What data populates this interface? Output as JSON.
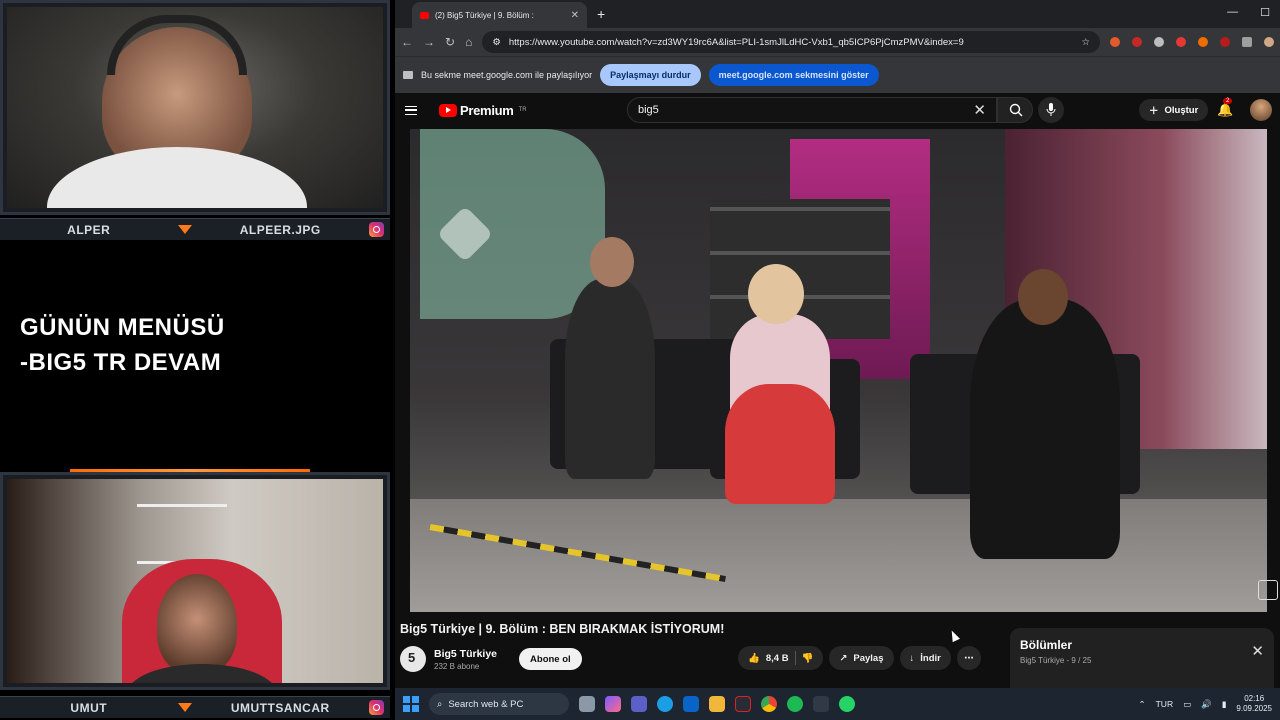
{
  "overlay": {
    "top_cam": {
      "left_name": "ALPER",
      "right_name": "ALPEER.JPG"
    },
    "bottom_cam": {
      "left_name": "UMUT",
      "right_name": "UMUTTSANCAR"
    },
    "menu_line1": "GÜNÜN MENÜSÜ",
    "menu_line2": "-BIG5 TR DEVAM"
  },
  "browser": {
    "tab_title": "(2) Big5 Türkiye | 9. Bölüm :",
    "url": "https://www.youtube.com/watch?v=zd3WY19rc6A&list=PLI-1smJlLdHC-Vxb1_qb5ICP6PjCmzPMV&index=9",
    "share_message": "Bu sekme meet.google.com ile paylaşılıyor",
    "stop_sharing": "Paylaşmayı durdur",
    "show_tab": "meet.google.com sekmesini göster"
  },
  "youtube": {
    "logo_text": "Premium",
    "logo_region": "TR",
    "search_value": "big5",
    "create_label": "Oluştur",
    "notif_count": "2",
    "video_title": "Big5 Türkiye | 9. Bölüm : BEN BIRAKMAK İSTİYORUM!",
    "channel_name": "Big5 Türkiye",
    "subscribers": "232 B abone",
    "subscribe_label": "Abone ol",
    "likes": "8,4 B",
    "share_label": "Paylaş",
    "download_label": "İndir",
    "playlist_title": "Bölümler",
    "playlist_sub": "Big5 Türkiye - 9 / 25"
  },
  "taskbar": {
    "search_placeholder": "Search web & PC",
    "lang": "TUR",
    "time": "02:16",
    "date": "9.09.2025"
  },
  "colors": {
    "accent_orange": "#ff7a1a",
    "yt_red": "#ff0000",
    "chrome_blue": "#0b57d0"
  }
}
